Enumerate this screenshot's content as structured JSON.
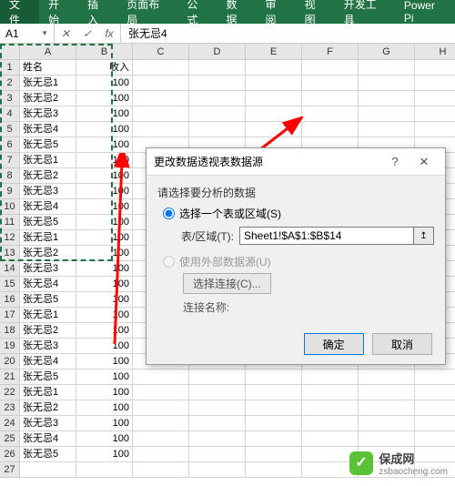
{
  "ribbon": {
    "tabs": [
      "文件",
      "开始",
      "插入",
      "页面布局",
      "公式",
      "数据",
      "审阅",
      "视图",
      "开发工具",
      "Power Pi"
    ]
  },
  "formulaBar": {
    "nameBox": "A1",
    "fx": "fx",
    "formula": "张无忌4"
  },
  "columns": [
    "A",
    "B",
    "C",
    "D",
    "E",
    "F",
    "G",
    "H"
  ],
  "rowCount": 27,
  "table": {
    "headers": [
      "姓名",
      "收入"
    ],
    "rows": [
      [
        "张无忌1",
        "100"
      ],
      [
        "张无忌2",
        "100"
      ],
      [
        "张无忌3",
        "100"
      ],
      [
        "张无忌4",
        "100"
      ],
      [
        "张无忌5",
        "100"
      ],
      [
        "张无忌1",
        "100"
      ],
      [
        "张无忌2",
        "100"
      ],
      [
        "张无忌3",
        "100"
      ],
      [
        "张无忌4",
        "100"
      ],
      [
        "张无忌5",
        "100"
      ],
      [
        "张无忌1",
        "100"
      ],
      [
        "张无忌2",
        "100"
      ],
      [
        "张无忌3",
        "100"
      ],
      [
        "张无忌4",
        "100"
      ],
      [
        "张无忌5",
        "100"
      ],
      [
        "张无忌1",
        "100"
      ],
      [
        "张无忌2",
        "100"
      ],
      [
        "张无忌3",
        "100"
      ],
      [
        "张无忌4",
        "100"
      ],
      [
        "张无忌5",
        "100"
      ],
      [
        "张无忌1",
        "100"
      ],
      [
        "张无忌2",
        "100"
      ],
      [
        "张无忌3",
        "100"
      ],
      [
        "张无忌4",
        "100"
      ],
      [
        "张无忌5",
        "100"
      ]
    ]
  },
  "dialog": {
    "title": "更改数据透视表数据源",
    "instruction": "请选择要分析的数据",
    "opt1": "选择一个表或区域(S)",
    "rangeLabel": "表/区域(T):",
    "rangeValue": "Sheet1!$A$1:$B$14",
    "opt2": "使用外部数据源(U)",
    "chooseConn": "选择连接(C)...",
    "connName": "连接名称:",
    "ok": "确定",
    "cancel": "取消"
  },
  "watermark": {
    "title": "保成网",
    "sub": "zsbaocheng.com"
  }
}
